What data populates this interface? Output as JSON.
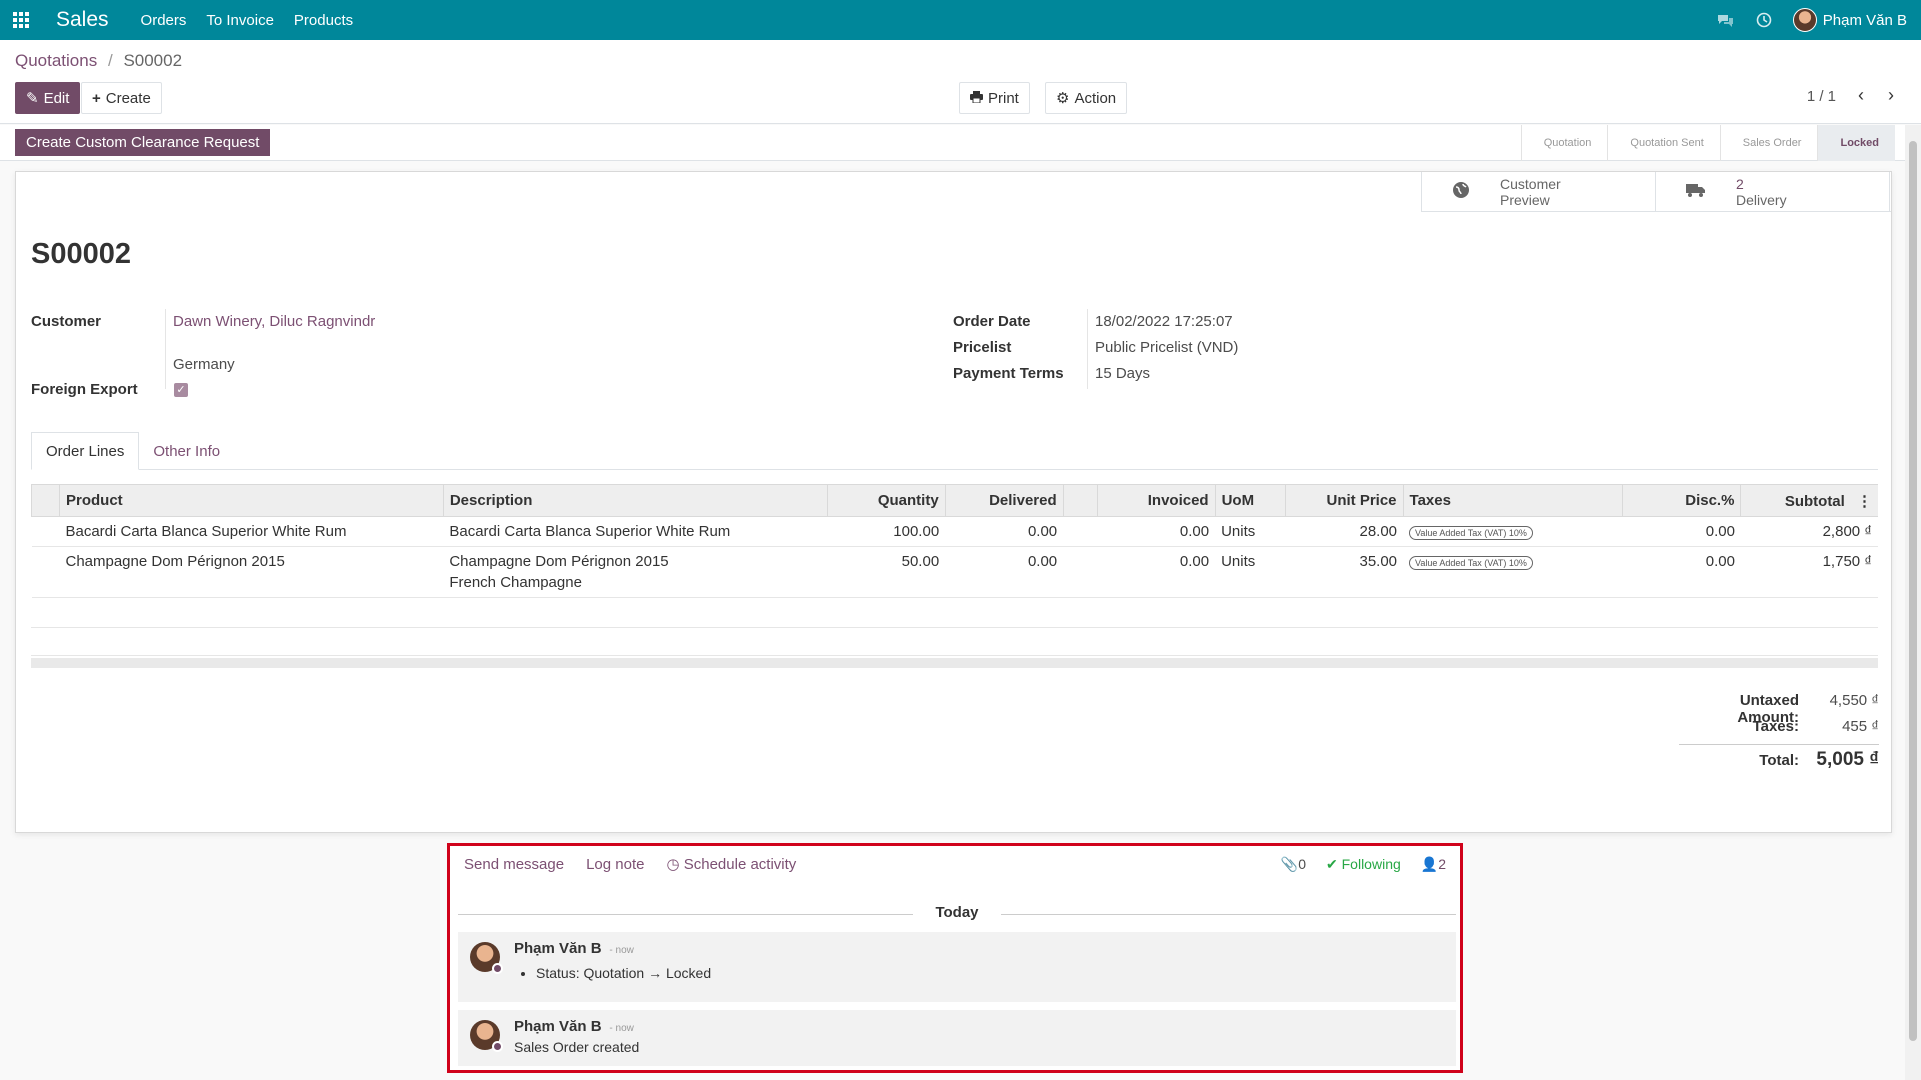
{
  "topbar": {
    "app": "Sales",
    "menu": [
      "Orders",
      "To Invoice",
      "Products"
    ],
    "user": "Phạm Văn B"
  },
  "breadcrumb": {
    "parent": "Quotations",
    "separator": "/",
    "current": "S00002"
  },
  "buttons": {
    "edit": "Edit",
    "create": "Create",
    "print": "Print",
    "action": "Action",
    "clearance": "Create Custom Clearance Request"
  },
  "pager": "1 / 1",
  "stages": [
    "Quotation",
    "Quotation Sent",
    "Sales Order",
    "Locked"
  ],
  "active_stage": "Locked",
  "smart_buttons": {
    "preview_line1": "Customer",
    "preview_line2": "Preview",
    "delivery_count": "2",
    "delivery_label": "Delivery"
  },
  "order": {
    "name": "S00002",
    "customer_label": "Customer",
    "customer": "Dawn Winery, Diluc Ragnvindr",
    "customer_country": "Germany",
    "foreign_export_label": "Foreign Export",
    "order_date_label": "Order Date",
    "order_date": "18/02/2022 17:25:07",
    "pricelist_label": "Pricelist",
    "pricelist": "Public Pricelist (VND)",
    "payment_terms_label": "Payment Terms",
    "payment_terms": "15 Days"
  },
  "tabs": [
    "Order Lines",
    "Other Info"
  ],
  "table": {
    "headers": [
      "Product",
      "Description",
      "Quantity",
      "Delivered",
      "Invoiced",
      "UoM",
      "Unit Price",
      "Taxes",
      "Disc.%",
      "Subtotal"
    ],
    "rows": [
      {
        "product": "Bacardi Carta Blanca Superior White Rum",
        "description": "Bacardi Carta Blanca Superior White Rum",
        "description2": "",
        "quantity": "100.00",
        "delivered": "0.00",
        "invoiced": "0.00",
        "uom": "Units",
        "unit_price": "28.00",
        "tax": "Value Added Tax (VAT) 10%",
        "disc": "0.00",
        "subtotal": "2,800 ₫"
      },
      {
        "product": "Champagne Dom Pérignon 2015",
        "description": "Champagne Dom Pérignon 2015",
        "description2": "French Champagne",
        "quantity": "50.00",
        "delivered": "0.00",
        "invoiced": "0.00",
        "uom": "Units",
        "unit_price": "35.00",
        "tax": "Value Added Tax (VAT) 10%",
        "disc": "0.00",
        "subtotal": "1,750 ₫"
      }
    ]
  },
  "totals": {
    "untaxed_label": "Untaxed Amount:",
    "untaxed": "4,550 ₫",
    "taxes_label": "Taxes:",
    "taxes": "455 ₫",
    "total_label": "Total:",
    "total": "5,005 ₫"
  },
  "chatter": {
    "send_message": "Send message",
    "log_note": "Log note",
    "schedule_activity": "Schedule activity",
    "attachments": "0",
    "following": "Following",
    "followers": "2",
    "date_separator": "Today",
    "messages": [
      {
        "author": "Phạm Văn B",
        "time": "- now",
        "body": "Status: Quotation → Locked"
      },
      {
        "author": "Phạm Văn B",
        "time": "- now",
        "body": "Sales Order created"
      }
    ]
  }
}
